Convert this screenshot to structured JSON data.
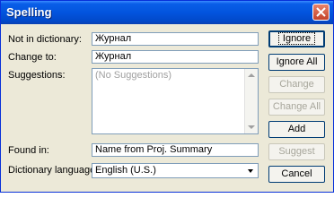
{
  "window": {
    "title": "Spelling"
  },
  "labels": {
    "not_in_dictionary": "Not in dictionary:",
    "change_to": "Change to:",
    "suggestions": "Suggestions:",
    "found_in": "Found in:",
    "dictionary_language": "Dictionary language:"
  },
  "fields": {
    "not_in_dictionary": "Журнал",
    "change_to": "Журнал",
    "found_in": "Name from Proj. Summary"
  },
  "suggestions": {
    "items": [
      "(No Suggestions)"
    ]
  },
  "language": {
    "selected": "English (U.S.)"
  },
  "buttons": {
    "ignore": "Ignore",
    "ignore_all": "Ignore All",
    "change": "Change",
    "change_all": "Change All",
    "add": "Add",
    "suggest": "Suggest",
    "cancel": "Cancel"
  },
  "colors": {
    "titlebar": "#0254de",
    "face": "#ece9d8",
    "border": "#7f9db9",
    "disabled_text": "#a7a69b"
  }
}
